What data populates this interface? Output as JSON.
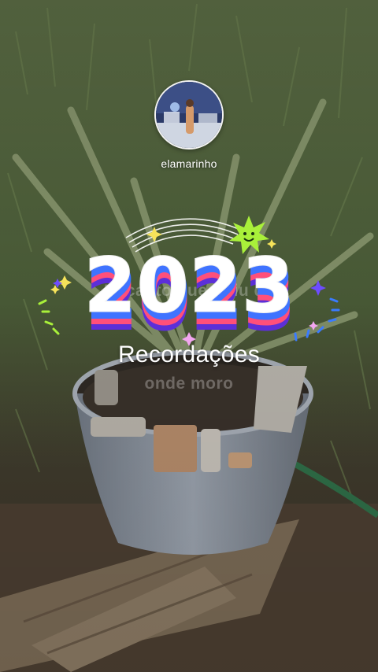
{
  "story": {
    "username": "elamarinho",
    "year": "2023",
    "subtitle": "Recordações",
    "overlay_text_line_1": "Recanto que uniu de",
    "overlay_text_line_2": "onde moro",
    "icons": [
      "avatar-photo",
      "smiley-sun-sticker",
      "sparkle-stars",
      "rainbow-arcs",
      "confetti-lines"
    ]
  }
}
